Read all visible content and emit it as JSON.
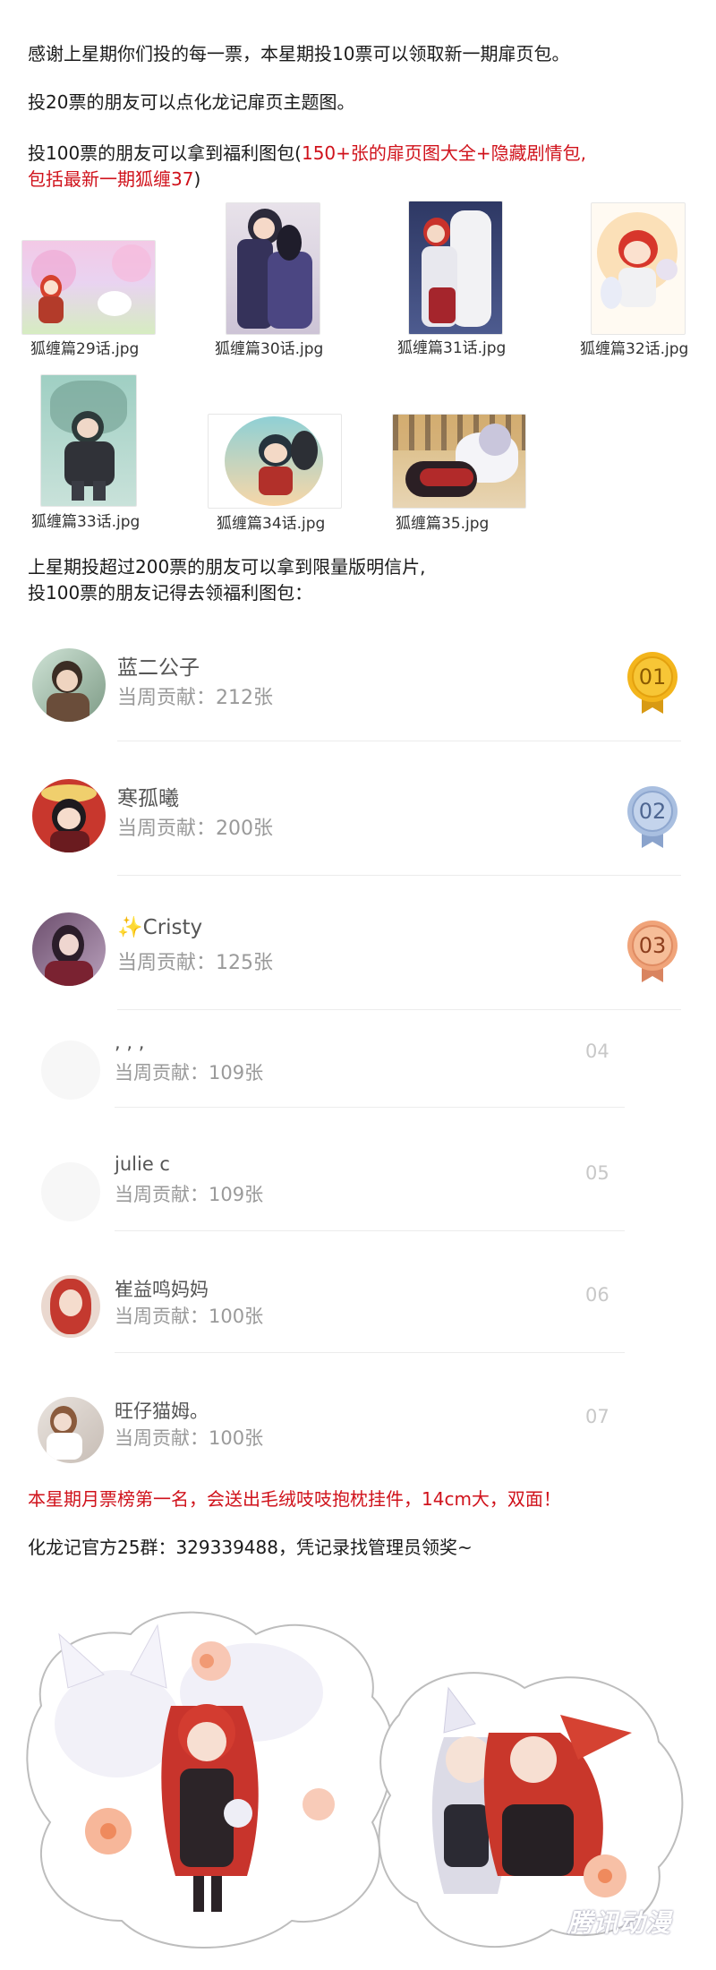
{
  "intro": {
    "line1": "感谢上星期你们投的每一票，本星期投10票可以领取新一期扉页包。",
    "line2": "投20票的朋友可以点化龙记扉页主题图。",
    "line3_prefix": "投100票的朋友可以拿到福利图包(",
    "line3_red": "150+张的扉页图大全+隐藏剧情包,",
    "line4_red": "包括最新一期狐缠37",
    "line4_suffix": ")"
  },
  "thumbnails": [
    {
      "caption": "狐缠篇29话.jpg"
    },
    {
      "caption": "狐缠篇30话.jpg"
    },
    {
      "caption": "狐缠篇31话.jpg"
    },
    {
      "caption": "狐缠篇32话.jpg"
    },
    {
      "caption": "狐缠篇33话.jpg"
    },
    {
      "caption": "狐缠篇34话.jpg"
    },
    {
      "caption": "狐缠篇35.jpg"
    }
  ],
  "mid": {
    "line1": "上星期投超过200票的朋友可以拿到限量版明信片,",
    "line2": "投100票的朋友记得去领福利图包："
  },
  "ranking": [
    {
      "rank": "01",
      "name": "蓝二公子",
      "contribution": "当周贡献：212张",
      "medal": "gold"
    },
    {
      "rank": "02",
      "name": "寒孤曦",
      "contribution": "当周贡献：200张",
      "medal": "silver"
    },
    {
      "rank": "03",
      "name": "Cristy",
      "contribution": "当周贡献：125张",
      "medal": "bronze"
    },
    {
      "rank": "04",
      "name": ", , ,",
      "contribution": "当周贡献：109张"
    },
    {
      "rank": "05",
      "name": "julie c",
      "contribution": "当周贡献：109张"
    },
    {
      "rank": "06",
      "name": "崔益鸣妈妈",
      "contribution": "当周贡献：100张"
    },
    {
      "rank": "07",
      "name": "旺仔猫姆。",
      "contribution": "当周贡献：100张"
    }
  ],
  "prize_line": "本星期月票榜第一名，会送出毛绒吱吱抱枕挂件，14cm大，双面！",
  "group_line": "化龙记官方25群：329339488，凭记录找管理员领奖~",
  "watermark": "腾讯动漫",
  "colors": {
    "accent_red": "#d0121b",
    "gold": "#f3b51c",
    "silver": "#a9bfe0",
    "bronze": "#f0a47a"
  }
}
